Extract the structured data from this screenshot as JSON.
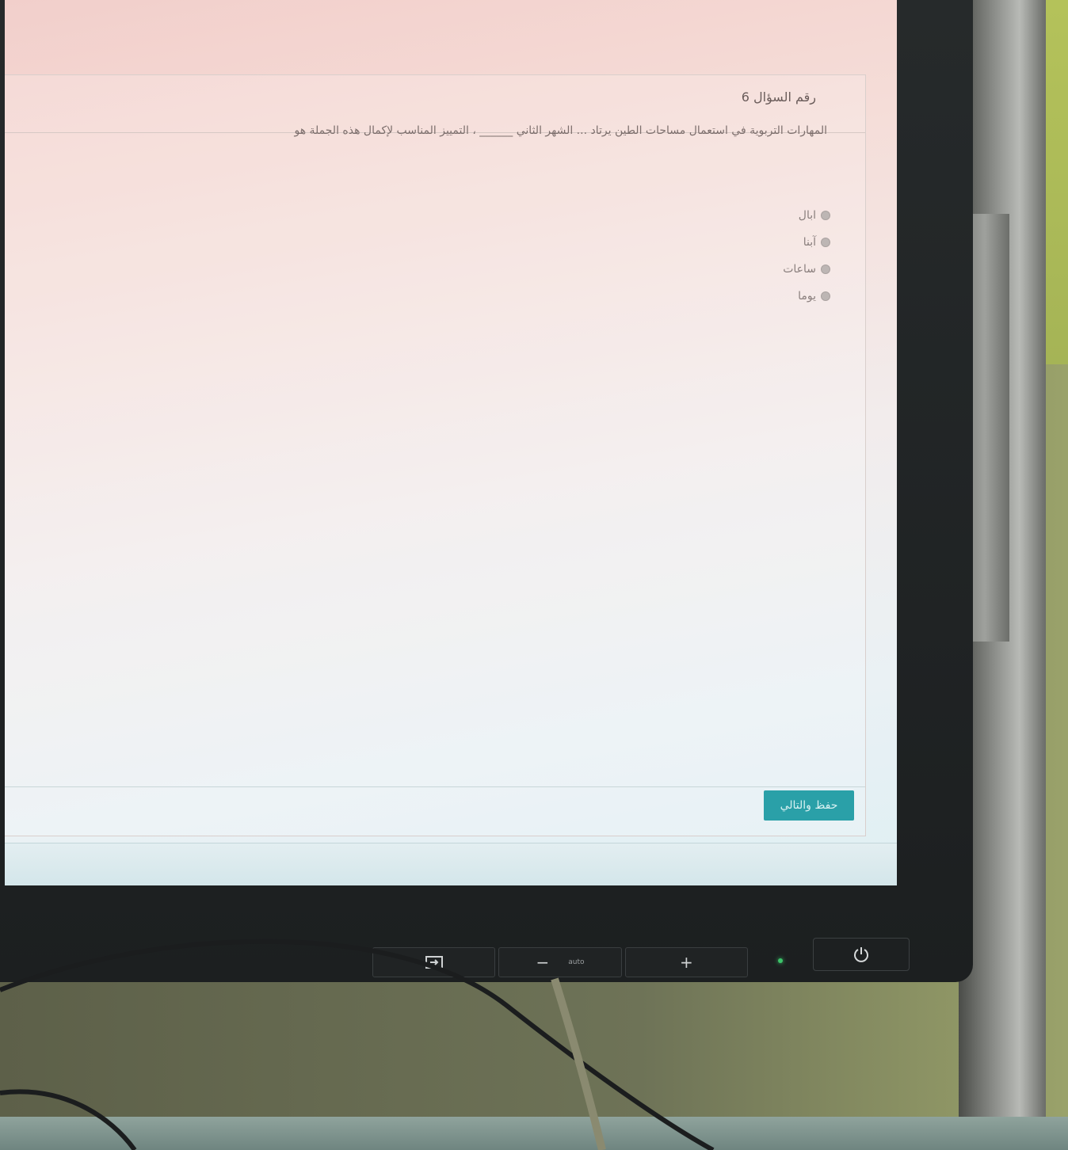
{
  "quiz": {
    "question_number_label": "رقم السؤال 6",
    "question_text": "المهارات التربوية في استعمال مساحات الطين يرتاد ... الشهر الثاني ______ ، التمييز المناسب لإكمال هذه الجملة هو",
    "options": [
      {
        "label": "ابال"
      },
      {
        "label": "آبنا"
      },
      {
        "label": "ساعات"
      },
      {
        "label": "يوما"
      }
    ],
    "next_button_label": "حفظ والتالي",
    "accent_color": "#2aa0a8"
  },
  "monitor": {
    "menu_icon": "input-icon",
    "minus_symbol": "−",
    "auto_label": "auto",
    "plus_symbol": "+",
    "power_icon": "power-icon"
  }
}
